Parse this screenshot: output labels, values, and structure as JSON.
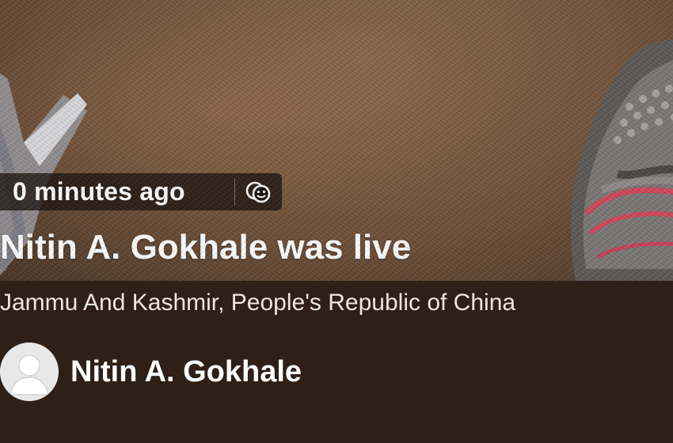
{
  "live_card": {
    "time_ago": "0 minutes ago",
    "reactions_icon": "reactions-icon",
    "title": "Nitin A. Gokhale was live",
    "location": "Jammu And Kashmir, People's Republic of China",
    "profile": {
      "name": "Nitin A. Gokhale",
      "avatar_icon": "default-avatar-icon"
    }
  },
  "colors": {
    "info_panel_bg": "#2e1f17",
    "pill_bg": "#19120e",
    "text_primary": "#ffffff",
    "text_secondary": "#ece6e2"
  }
}
